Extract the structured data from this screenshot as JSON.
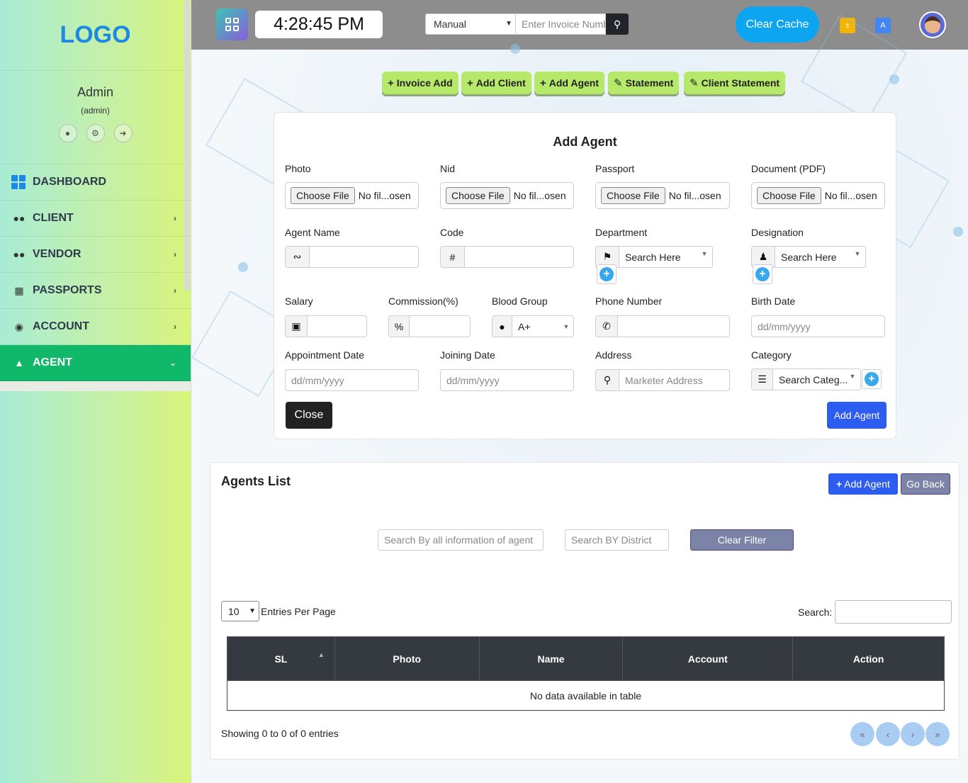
{
  "sidebar": {
    "logo": "LOGO",
    "user_name": "Admin",
    "user_role": "(admin)",
    "items": [
      {
        "label": "DASHBOARD"
      },
      {
        "label": "CLIENT"
      },
      {
        "label": "VENDOR"
      },
      {
        "label": "PASSPORTS"
      },
      {
        "label": "ACCOUNT"
      },
      {
        "label": "AGENT"
      }
    ]
  },
  "topbar": {
    "time": "4:28:45 PM",
    "invoice_type": "Manual",
    "invoice_placeholder": "Enter Invoice Number",
    "clear_cache": "Clear Cache"
  },
  "quick_actions": [
    "Invoice Add",
    "Add Client",
    "Add Agent",
    "Statement",
    "Client Statement"
  ],
  "form": {
    "title": "Add Agent",
    "choose_file": "Choose File",
    "no_file": "No fil...osen",
    "photo_label": "Photo",
    "nid_label": "Nid",
    "passport_label": "Passport",
    "document_label": "Document (PDF)",
    "agent_name_label": "Agent Name",
    "code_label": "Code",
    "department_label": "Department",
    "designation_label": "Designation",
    "search_here": "Search Here",
    "salary_label": "Salary",
    "commission_label": "Commission(%)",
    "blood_group_label": "Blood Group",
    "blood_group_value": "A+",
    "phone_label": "Phone Number",
    "birth_date_label": "Birth Date",
    "date_placeholder": "dd/mm/yyyy",
    "appointment_label": "Appointment Date",
    "joining_label": "Joining Date",
    "address_label": "Address",
    "address_placeholder": "Marketer Address",
    "category_label": "Category",
    "category_placeholder": "Search Categ...",
    "close_button": "Close",
    "add_button": "Add Agent"
  },
  "list": {
    "title": "Agents List",
    "add_agent": "Add Agent",
    "go_back": "Go Back",
    "search_all_placeholder": "Search By all information of agent",
    "search_district_placeholder": "Search BY District",
    "clear_filter": "Clear Filter",
    "entries_value": "10",
    "entries_label": "Entries Per Page",
    "search_label": "Search:",
    "columns": [
      "SL",
      "Photo",
      "Name",
      "Account",
      "Action"
    ],
    "empty_text": "No data available in table",
    "showing": "Showing 0 to 0 of 0 entries",
    "pager": [
      "«",
      "‹",
      "›",
      "»"
    ]
  },
  "colors": {
    "active_menu": "#10b86a",
    "primary_button": "#2d5cf0",
    "clear_cache": "#0ea5f0",
    "quick_action": "#b6e96a"
  }
}
